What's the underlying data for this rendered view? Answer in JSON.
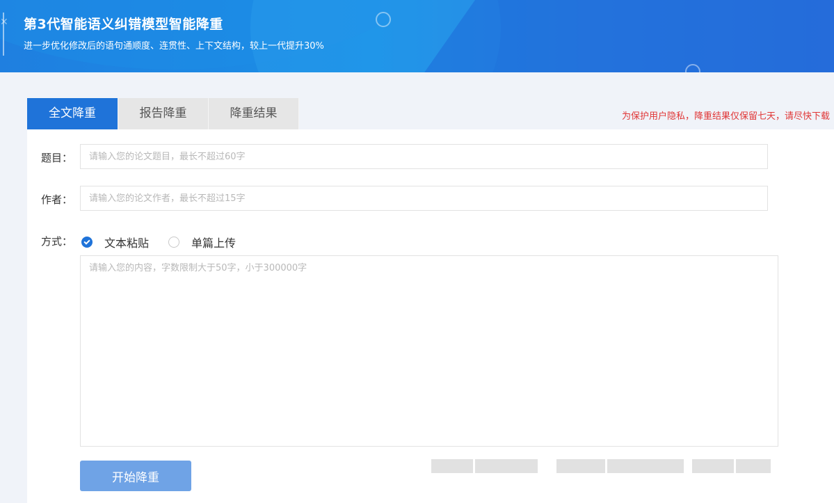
{
  "banner": {
    "title": "第3代智能语义纠错模型智能降重",
    "subtitle": "进一步优化修改后的语句通顺度、连贯性、上下文结构，较上一代提升30%"
  },
  "tabs": [
    {
      "label": "全文降重",
      "active": true
    },
    {
      "label": "报告降重",
      "active": false
    },
    {
      "label": "降重结果",
      "active": false
    }
  ],
  "privacy_notice": "为保护用户隐私，降重结果仅保留七天，请尽快下载",
  "form": {
    "title_label": "题目：",
    "title_placeholder": "请输入您的论文题目，最长不超过60字",
    "author_label": "作者：",
    "author_placeholder": "请输入您的论文作者，最长不超过15字",
    "method_label": "方式：",
    "methods": [
      {
        "label": "文本粘贴",
        "checked": true
      },
      {
        "label": "单篇上传",
        "checked": false
      }
    ],
    "content_placeholder": "请输入您的内容，字数限制大于50字，小于300000字",
    "submit_label": "开始降重"
  },
  "colors": {
    "accent": "#1f73d9",
    "button": "#6fa3e6",
    "notice": "#e03636"
  }
}
